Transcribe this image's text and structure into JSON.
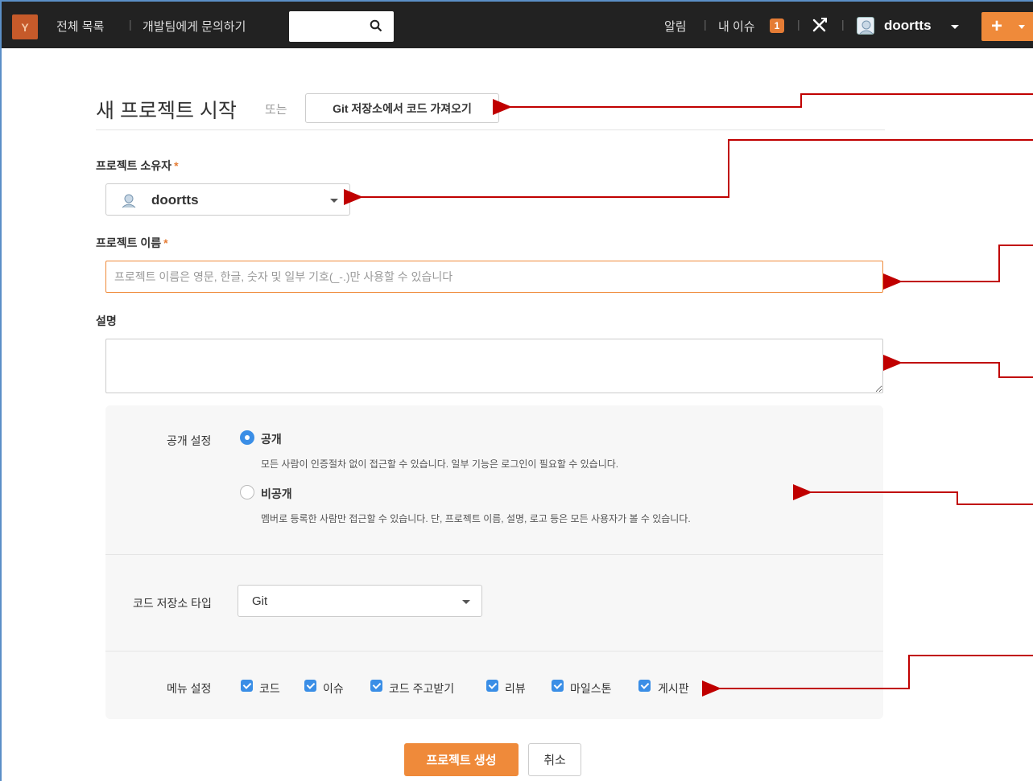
{
  "navbar": {
    "logo_letter": "Y",
    "links": [
      "전체 목록",
      "개발팀에게 문의하기"
    ],
    "search_placeholder": "",
    "alerts_label": "알림",
    "my_issues_label": "내 이슈",
    "issue_count": "1",
    "user_name": "doortts",
    "add_label": "+",
    "separator": "|"
  },
  "header": {
    "title": "새 프로젝트 시작",
    "or_text": "또는",
    "import_button": "Git 저장소에서 코드 가져오기"
  },
  "form": {
    "owner_label": "프로젝트 소유자",
    "owner_value": "doortts",
    "name_label": "프로젝트 이름",
    "name_placeholder": "프로젝트 이름은 영문, 한글, 숫자 및 일부 기호(_-.)만 사용할 수 있습니다",
    "description_label": "설명",
    "required_mark": "*"
  },
  "settings": {
    "visibility_label": "공개 설정",
    "public_label": "공개",
    "public_desc": "모든 사람이 인증절차 없이 접근할 수 있습니다. 일부 기능은 로그인이 필요할 수 있습니다.",
    "private_label": "비공개",
    "private_desc": "멤버로 등록한 사람만 접근할 수 있습니다. 단, 프로젝트 이름, 설명, 로고 등은 모든 사용자가 볼 수 있습니다.",
    "repo_type_label": "코드 저장소 타입",
    "repo_type_value": "Git",
    "menu_label": "메뉴 설정",
    "menu_items": [
      "코드",
      "이슈",
      "코드 주고받기",
      "리뷰",
      "마일스톤",
      "게시판"
    ]
  },
  "actions": {
    "create_label": "프로젝트 생성",
    "cancel_label": "취소"
  },
  "colors": {
    "accent": "#ef8a3a",
    "navbar": "#222222",
    "check": "#3a8ee6",
    "annotation": "#c00000"
  }
}
